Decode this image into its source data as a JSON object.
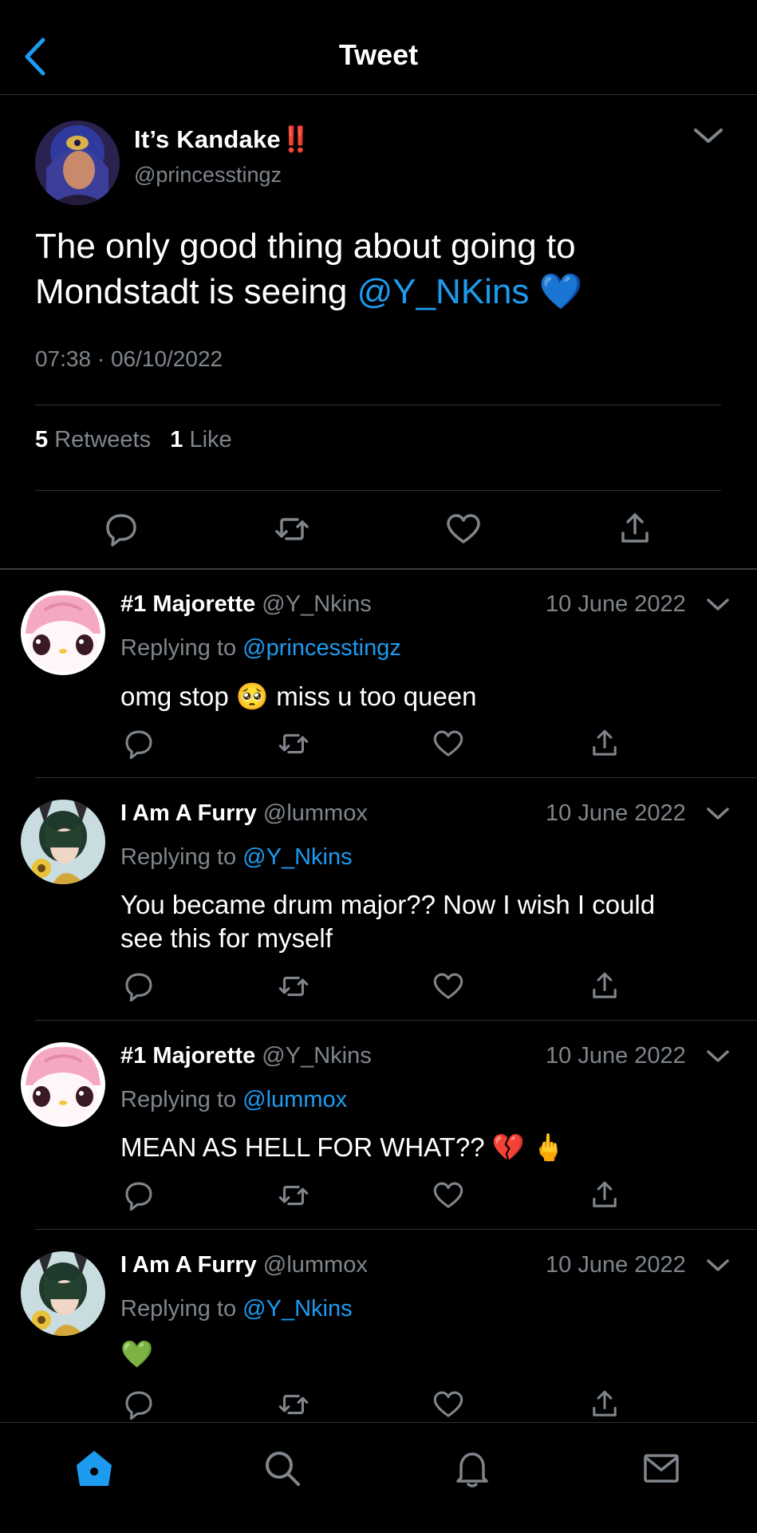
{
  "header": {
    "title": "Tweet"
  },
  "main_tweet": {
    "display_name": "It’s Kandake",
    "name_emoji": "‼️",
    "handle": "@princesstingz",
    "text_line1": "The only good thing about going to",
    "text_line2_prefix": "Mondstadt is seeing ",
    "mention": "@Y_NKins",
    "text_emoji": "💙",
    "timestamp": "07:38 · 06/10/2022",
    "retweet_count": "5",
    "retweet_label": "Retweets",
    "like_count": "1",
    "like_label": "Like"
  },
  "replies": [
    {
      "name": "#1 Majorette",
      "handle": "@Y_Nkins",
      "date": "10 June 2022",
      "replying_label": "Replying to",
      "replying_to": "@princesstingz",
      "text_a": "omg stop",
      "text_b": "miss u too queen",
      "emoji": "🥺"
    },
    {
      "name": "I Am A Furry",
      "handle": "@lummox",
      "date": "10 June 2022",
      "replying_label": "Replying to",
      "replying_to": "@Y_Nkins",
      "text_line1": "You became drum major?? Now I wish I could",
      "text_line2": "see this for myself"
    },
    {
      "name": "#1 Majorette",
      "handle": "@Y_Nkins",
      "date": "10 June 2022",
      "replying_label": "Replying to",
      "replying_to": "@lummox",
      "text": "MEAN AS HELL FOR WHAT??",
      "emoji_1": "💔",
      "emoji_2": "🖕"
    },
    {
      "name": "I Am A Furry",
      "handle": "@lummox",
      "date": "10 June 2022",
      "replying_label": "Replying to",
      "replying_to": "@Y_Nkins",
      "emoji": "💚"
    }
  ],
  "tabbar": {
    "tabs": [
      "home",
      "search",
      "notifications",
      "messages"
    ],
    "active": "home"
  },
  "colors": {
    "background": "#000000",
    "accent": "#1d9bf0",
    "secondary_text": "#7f858b",
    "divider": "#2f3336"
  },
  "icons": [
    "back-chevron-icon",
    "chevron-down-icon",
    "reply-icon",
    "retweet-icon",
    "like-icon",
    "share-icon",
    "home-icon",
    "search-icon",
    "bell-icon",
    "mail-icon"
  ]
}
